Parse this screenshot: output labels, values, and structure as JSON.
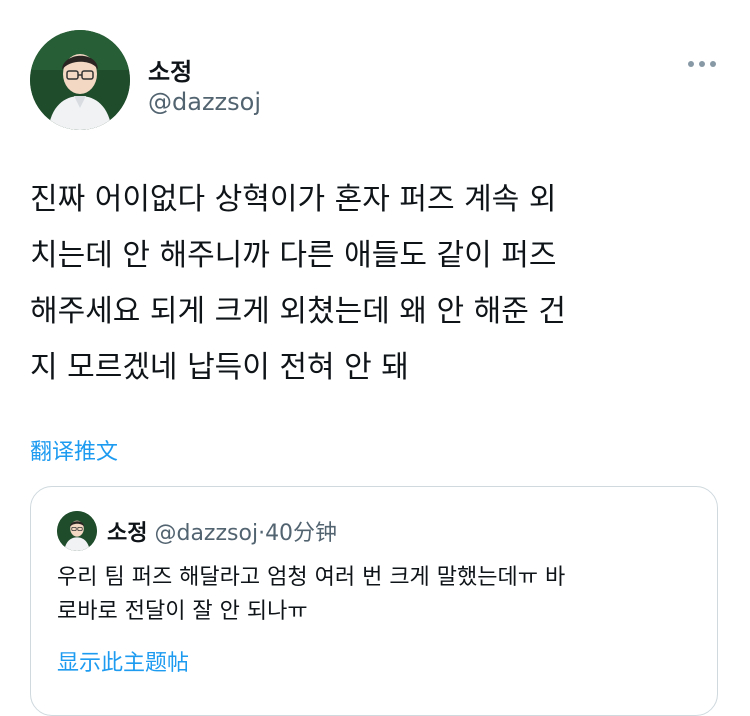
{
  "author": {
    "name": "소정",
    "handle": "@dazzsoj"
  },
  "tweet": {
    "lines": [
      "진짜 어이없다 상혁이가 혼자 퍼즈 계속 외",
      "치는데 안 해주니까 다른 애들도 같이 퍼즈",
      "해주세요 되게 크게 외쳤는데 왜 안 해준 건",
      "지 모르겠네 납득이 전혀 안 돼"
    ],
    "translate_label": "翻译推文"
  },
  "quote": {
    "name": "소정",
    "handle": "@dazzsoj",
    "separator": "·",
    "time": "40分钟",
    "lines": [
      "우리 팀 퍼즈 해달라고 엄청 여러 번 크게 말했는데ㅠ 바",
      "로바로 전달이 잘 안 되나ㅠ"
    ],
    "show_thread_label": "显示此主题帖"
  },
  "icons": {
    "avatar": "profile-photo",
    "more": "more-dots-icon"
  },
  "colors": {
    "link": "#1d9bf0",
    "secondary_text": "#536471",
    "border": "#cfd9de"
  }
}
